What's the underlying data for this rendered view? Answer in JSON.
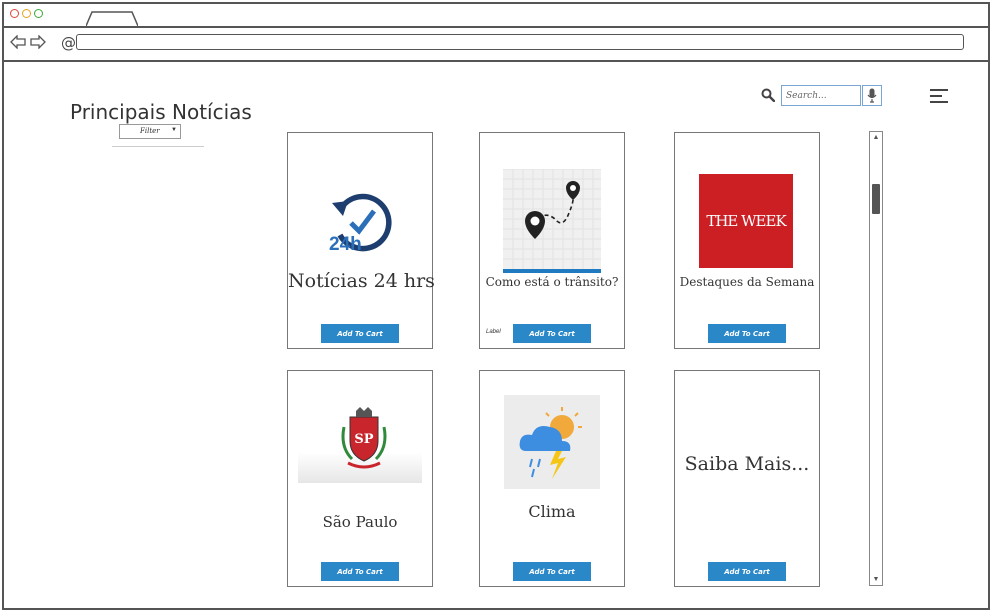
{
  "browser": {
    "url": ""
  },
  "page": {
    "title": "Principais Notícias",
    "filter_label": "Filter",
    "search_placeholder": "Search..."
  },
  "cards": [
    {
      "title": "Notícias 24 hrs",
      "image_text": "24h",
      "button": "Add To Cart"
    },
    {
      "title": "Como está o trânsito?",
      "button": "Add To Cart",
      "extra_label": "Label"
    },
    {
      "title": "Destaques da Semana",
      "image_text": "THE WEEK",
      "button": "Add To Cart"
    },
    {
      "title": "São Paulo",
      "image_text": "SP",
      "button": "Add To Cart"
    },
    {
      "title": "Clima",
      "button": "Add To Cart"
    },
    {
      "title": "Saiba Mais...",
      "button": "Add To Cart"
    }
  ],
  "colors": {
    "button": "#2a88c8",
    "theweek_red": "#cc1f24",
    "clock_blue": "#2a6fb8"
  }
}
